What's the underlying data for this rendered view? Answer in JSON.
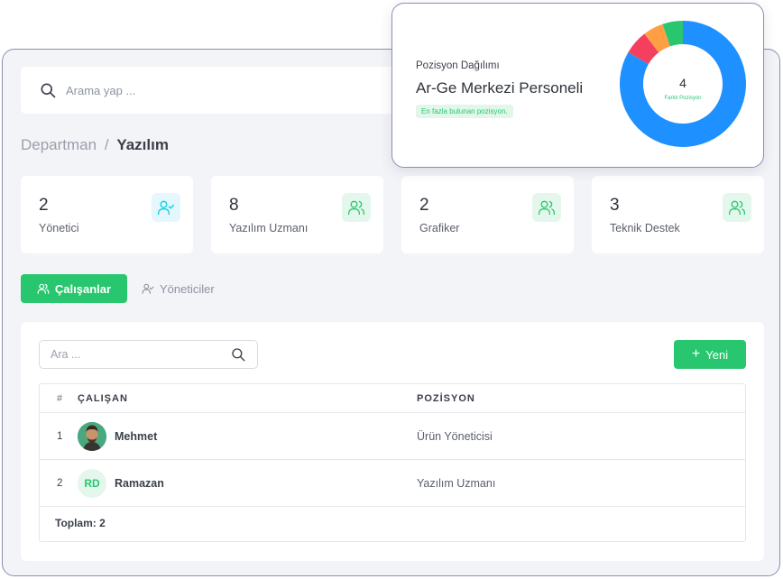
{
  "search": {
    "placeholder": "Arama yap ..."
  },
  "breadcrumb": {
    "parent": "Departman",
    "separator": "/",
    "current": "Yazılım"
  },
  "stats": [
    {
      "value": "2",
      "label": "Yönetici",
      "icon": "user-check-icon",
      "color": "#00cfe8"
    },
    {
      "value": "8",
      "label": "Yazılım Uzmanı",
      "icon": "users-icon",
      "color": "#28c76f"
    },
    {
      "value": "2",
      "label": "Grafiker",
      "icon": "users-icon",
      "color": "#28c76f"
    },
    {
      "value": "3",
      "label": "Teknik Destek",
      "icon": "users-icon",
      "color": "#28c76f"
    }
  ],
  "tabs": [
    {
      "label": "Çalışanlar",
      "active": true
    },
    {
      "label": "Yöneticiler",
      "active": false
    }
  ],
  "filter": {
    "placeholder": "Ara ..."
  },
  "new_button": {
    "label": "Yeni"
  },
  "table": {
    "headers": {
      "index": "#",
      "employee": "ÇALIŞAN",
      "position": "POZİSYON"
    },
    "rows": [
      {
        "index": "1",
        "name": "Mehmet",
        "position": "Ürün Yöneticisi",
        "avatar": "photo"
      },
      {
        "index": "2",
        "name": "Ramazan",
        "position": "Yazılım Uzmanı",
        "avatar": "RD"
      }
    ],
    "footer": "Toplam: 2"
  },
  "popup": {
    "subtitle": "Pozisyon Dağılımı",
    "title": "Ar-Ge Merkezi Personeli",
    "badge": "En fazla bulunan pozisyon.",
    "center_value": "4",
    "center_label": "Farklı Pozisyon"
  },
  "chart_data": {
    "type": "pie",
    "categories": [
      "Yazılım Uzmanı",
      "Teknik Destek",
      "Grafiker",
      "Yönetici"
    ],
    "values": [
      8,
      0.6,
      0.5,
      0.5
    ],
    "colors": [
      "#1e90ff",
      "#f43f5e",
      "#ff9f43",
      "#28c76f"
    ]
  },
  "colors": {
    "accent": "#28c76f",
    "info": "#00cfe8",
    "primary_chart": "#1e90ff"
  }
}
